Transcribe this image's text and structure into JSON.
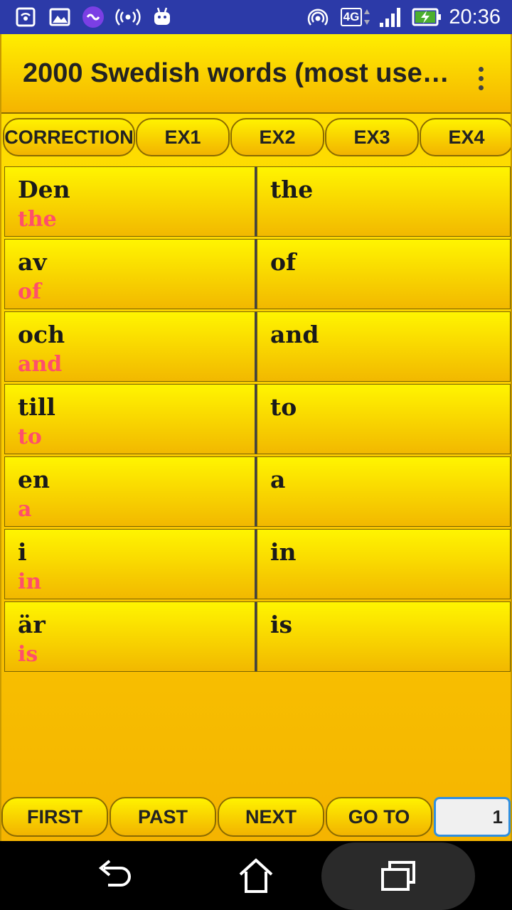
{
  "status_bar": {
    "time": "20:36",
    "network": "4G",
    "icons": [
      "hotspot-icon",
      "gallery-icon",
      "sync-app-icon",
      "broadcast-icon",
      "android-icon",
      "hotspot-icon",
      "signal-icon",
      "battery-charging-icon"
    ]
  },
  "toolbar": {
    "title": "2000 Swedish words (most use…",
    "menu_icon": "more-vert-icon"
  },
  "tabs": [
    {
      "label": "CORRECTION"
    },
    {
      "label": "EX1"
    },
    {
      "label": "EX2"
    },
    {
      "label": "EX3"
    },
    {
      "label": "EX4"
    }
  ],
  "words": [
    {
      "swedish": "Den",
      "hint": "the",
      "english": "the"
    },
    {
      "swedish": "av",
      "hint": "of",
      "english": "of"
    },
    {
      "swedish": "och",
      "hint": "and",
      "english": "and"
    },
    {
      "swedish": "till",
      "hint": "to",
      "english": "to"
    },
    {
      "swedish": "en",
      "hint": "a",
      "english": "a"
    },
    {
      "swedish": "i",
      "hint": "in",
      "english": "in"
    },
    {
      "swedish": "är",
      "hint": "is",
      "english": "is"
    }
  ],
  "bottom_bar": {
    "first": "FIRST",
    "past": "PAST",
    "next": "NEXT",
    "goto": "GO TO",
    "page_value": "1"
  },
  "colors": {
    "status_bar": "#2c3aa8",
    "app_background": "#f5c400",
    "hint_text": "#ff4f6b",
    "page_input_focus": "#2f8fe0"
  },
  "nav_bar": {
    "icons": [
      "back-icon",
      "home-icon",
      "recent-apps-icon"
    ]
  }
}
